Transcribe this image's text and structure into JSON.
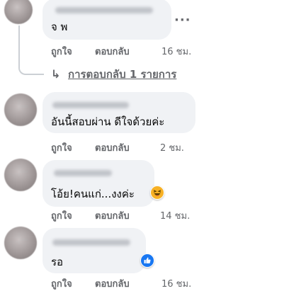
{
  "comments": [
    {
      "text": "จ พ",
      "like": "ถูกใจ",
      "reply": "ตอบกลับ",
      "time": "16 ชม.",
      "more_icon": "ellipsis-icon"
    },
    {
      "text": "อันนี้สอบผ่าน ดีใจด้วยค่ะ",
      "like": "ถูกใจ",
      "reply": "ตอบกลับ",
      "time": "2 ชม."
    },
    {
      "text": "โอ้ย!คนแก่...งงค่ะ",
      "like": "ถูกใจ",
      "reply": "ตอบกลับ",
      "time": "14 ชม.",
      "reaction": "haha-icon"
    },
    {
      "text": "รอ",
      "like": "ถูกใจ",
      "reply": "ตอบกลับ",
      "time": "16 ชม.",
      "reaction": "like-icon"
    }
  ],
  "replies_link": {
    "label": "การตอบกลับ 1 รายการ",
    "icon": "reply-arrow-icon"
  },
  "colors": {
    "bubble": "#f0f2f5",
    "meta_text": "#65676b",
    "like_blue": "#1877f2",
    "haha_yellow": "#f7b125"
  }
}
